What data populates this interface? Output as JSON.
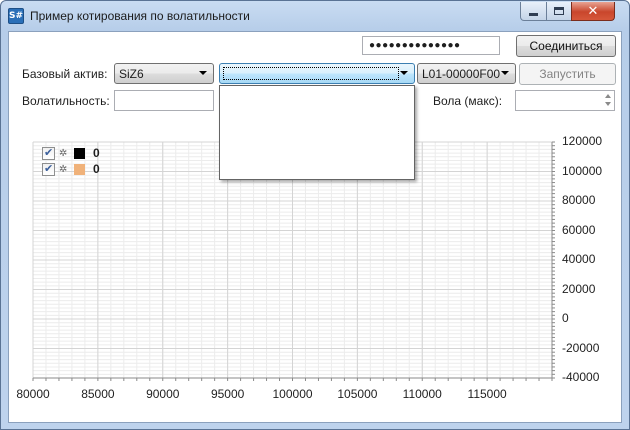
{
  "window": {
    "title": "Пример котирования по волатильности",
    "app_icon_text": "S#"
  },
  "toolbar": {
    "password_mask": "●●●●●●●●●●●●●●",
    "connect_label": "Соединиться",
    "start_label": "Запустить"
  },
  "form": {
    "base_asset_label": "Базовый актив:",
    "base_asset_value": "SiZ6",
    "option_combo_value": "",
    "portfolio_value": "L01-00000F00",
    "volatility_label": "Волатильность:",
    "volatility_value": "",
    "vol_max_label": "Вола (макс):",
    "vol_max_value": ""
  },
  "chart": {
    "legend": [
      {
        "value": "0",
        "color": "#000000",
        "checked": true,
        "icon": "gear-icon"
      },
      {
        "value": "0",
        "color": "#f0b27a",
        "checked": true,
        "icon": "gear-icon"
      }
    ],
    "grid_color": "#e6e6e6"
  },
  "chart_data": {
    "type": "line",
    "xlim": [
      80000,
      120000
    ],
    "ylim": [
      -40000,
      120000
    ],
    "x_ticks": [
      "80000",
      "85000",
      "90000",
      "95000",
      "100000",
      "105000",
      "110000",
      "115000"
    ],
    "y_ticks": [
      "120000",
      "100000",
      "80000",
      "60000",
      "40000",
      "20000",
      "0",
      "-20000",
      "-40000"
    ],
    "series": [
      {
        "name": "0",
        "values": []
      },
      {
        "name": "0",
        "values": []
      }
    ],
    "grid": true,
    "legend_position": "top-left"
  }
}
